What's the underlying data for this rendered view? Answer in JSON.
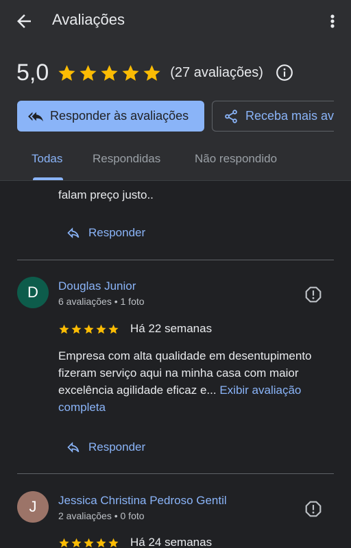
{
  "header": {
    "title": "Avaliações",
    "rating_value": "5,0",
    "rating_count": "(27 avaliações)",
    "reply_button_label": "Responder às avaliações",
    "more_reviews_button_label": "Receba mais avaliações"
  },
  "tabs": [
    {
      "label": "Todas"
    },
    {
      "label": "Respondidas"
    },
    {
      "label": "Não respondido"
    }
  ],
  "prev_review": {
    "text": "falam preço justo..",
    "reply_label": "Responder"
  },
  "reviews": [
    {
      "initial": "D",
      "avatar_color": "#0d5c4b",
      "name": "Douglas Junior",
      "meta": "6 avaliações • 1 foto",
      "stars": 5,
      "time": "Há 22 semanas",
      "text": "Empresa com alta qualidade em desentupimento fizeram serviço aqui na minha casa com maior excelência agilidade eficaz e...",
      "more_label": "Exibir avaliação completa",
      "reply_label": "Responder"
    },
    {
      "initial": "J",
      "avatar_color": "#9c7468",
      "name": "Jessica Christina Pedroso Gentil",
      "meta": "2 avaliações • 0 foto",
      "stars": 5,
      "time": "Há 24 semanas"
    }
  ],
  "colors": {
    "accent": "#8ab4f8",
    "star": "#fbbc04",
    "background": "#202124",
    "header_background": "#2d2e31"
  },
  "icons": [
    "back-arrow-icon",
    "more-vert-icon",
    "star-icon",
    "info-icon",
    "reply-all-icon",
    "share-icon",
    "reply-icon",
    "report-icon"
  ]
}
